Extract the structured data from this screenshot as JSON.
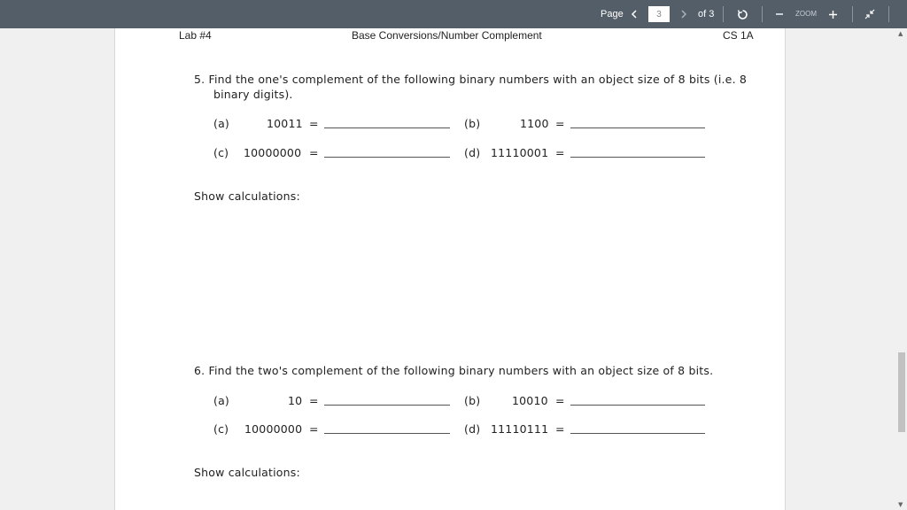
{
  "toolbar": {
    "page_label": "Page",
    "page_value": "3",
    "of_label": "of 3",
    "zoom_label": "ZOOM"
  },
  "header": {
    "left": "Lab #4",
    "center": "Base Conversions/Number Complement",
    "right": "CS 1A"
  },
  "q5": {
    "line1": "5.  Find the one's complement of the following binary numbers with an object size of 8 bits (i.e. 8",
    "line2": "binary digits).",
    "a_label": "(a)",
    "a_value": "10011",
    "b_label": "(b)",
    "b_value": "1100",
    "c_label": "(c)",
    "c_value": "10000000",
    "d_label": "(d)",
    "d_value": "11110001",
    "equals": "=",
    "show": "Show calculations:"
  },
  "q6": {
    "line1": "6.  Find the two's complement of the following binary numbers with an object size of 8 bits.",
    "a_label": "(a)",
    "a_value": "10",
    "b_label": "(b)",
    "b_value": "10010",
    "c_label": "(c)",
    "c_value": "10000000",
    "d_label": "(d)",
    "d_value": "11110111",
    "equals": "=",
    "show": "Show calculations:"
  }
}
